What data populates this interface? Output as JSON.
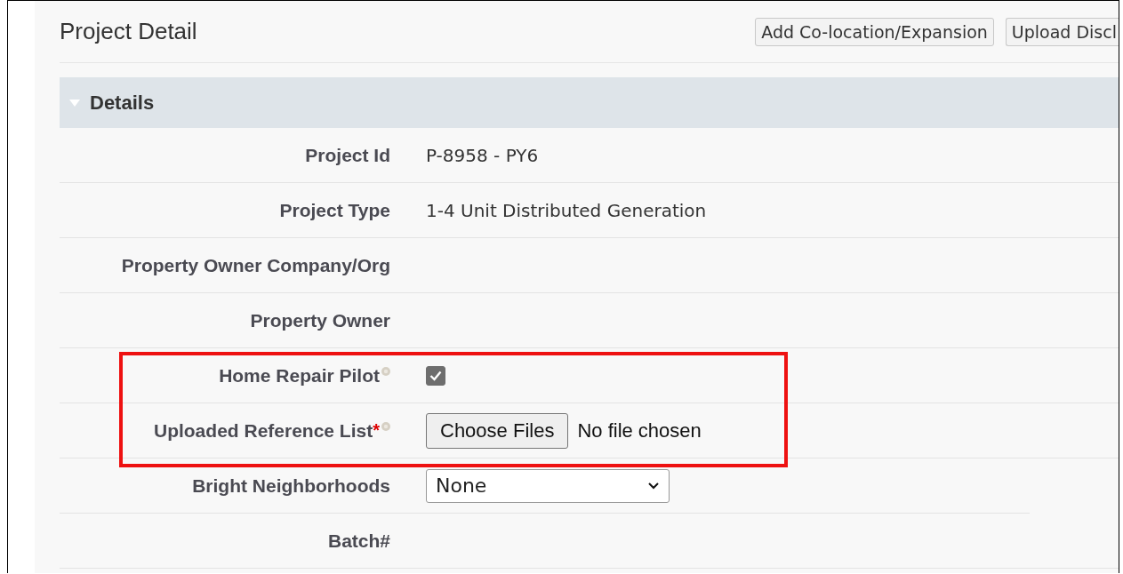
{
  "header": {
    "title": "Project Detail",
    "buttons": [
      "Add Co-location/Expansion",
      "Upload Discl"
    ]
  },
  "section": {
    "title": "Details",
    "expanded": true
  },
  "fields": [
    {
      "kind": "text",
      "label": "Project Id",
      "value": "P-8958 - PY6",
      "highlighted": false
    },
    {
      "kind": "text",
      "label": "Project Type",
      "value": "1-4 Unit Distributed Generation",
      "highlighted": false
    },
    {
      "kind": "text",
      "label": "Property Owner Company/Org",
      "highlighted": false
    },
    {
      "kind": "text",
      "label": "Property Owner",
      "highlighted": false
    },
    {
      "kind": "checkbox",
      "label": "Home Repair Pilot",
      "help": true,
      "checked": true,
      "highlighted": true
    },
    {
      "kind": "file",
      "label": "Uploaded Reference List",
      "required_mark": "*",
      "help": true,
      "button": "Choose Files",
      "status": "No file chosen",
      "highlighted": true
    },
    {
      "kind": "select",
      "label": "Bright Neighborhoods",
      "value": "None",
      "highlighted": false
    },
    {
      "kind": "text",
      "label": "Batch#",
      "highlighted": false
    }
  ]
}
